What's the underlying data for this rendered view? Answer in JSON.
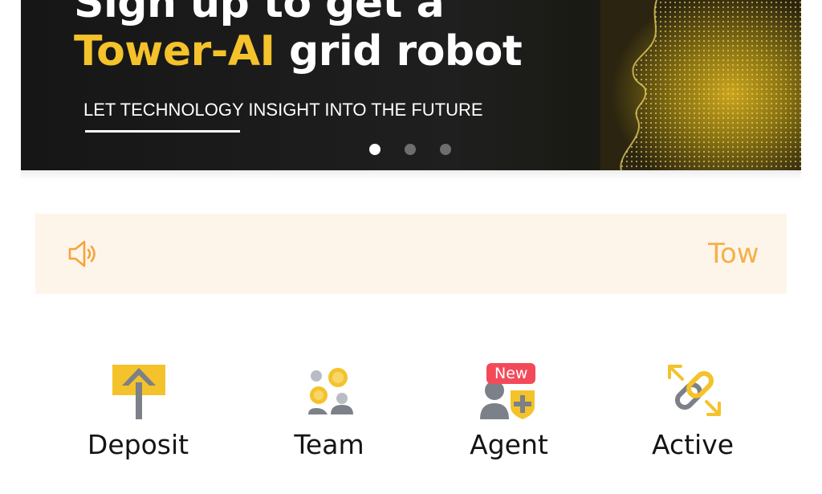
{
  "banner": {
    "headline_line1": "Sign up to get a",
    "headline_accent": "Tower-AI",
    "headline_rest": " grid robot",
    "tagline": "LET TECHNOLOGY INSIGHT INTO THE FUTURE",
    "slides": 3,
    "active_slide": 1,
    "accent_color": "#f4c22b"
  },
  "notice": {
    "icon": "speaker-icon",
    "text": "Tow",
    "text_color": "#f5b04a",
    "background": "#fef5ea"
  },
  "menu": {
    "items": [
      {
        "label": "Deposit",
        "icon": "upload-arrow-icon"
      },
      {
        "label": "Team",
        "icon": "team-icon"
      },
      {
        "label": "Agent",
        "icon": "agent-icon",
        "badge": "New"
      },
      {
        "label": "Active",
        "icon": "link-icon"
      }
    ]
  }
}
